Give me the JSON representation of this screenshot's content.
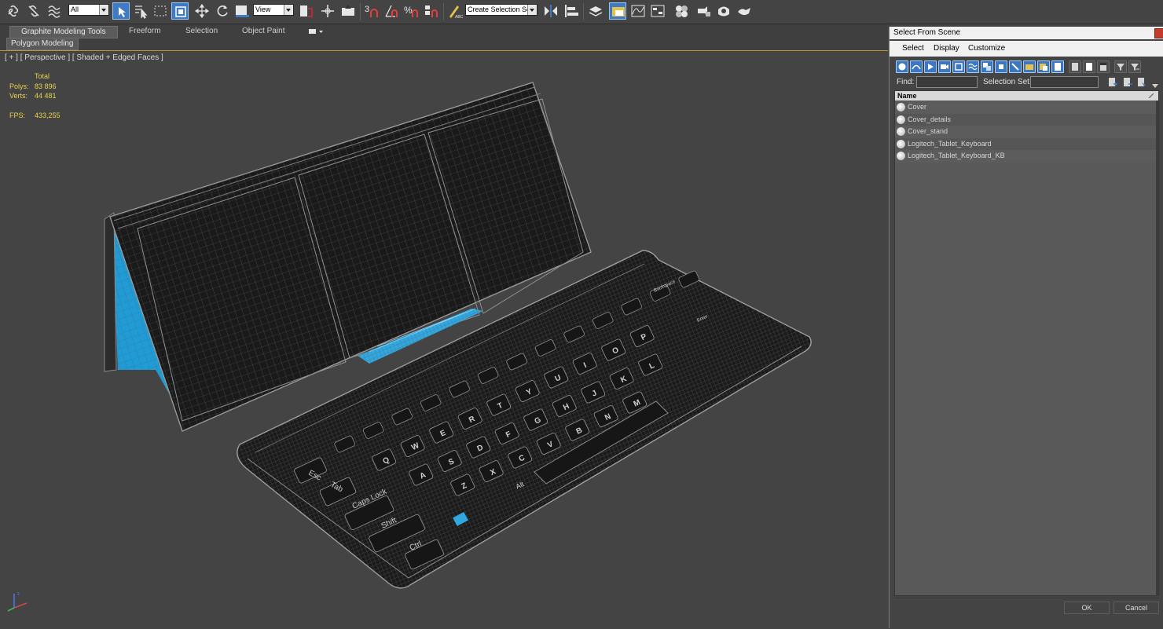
{
  "toolbar": {
    "filter_select": "All",
    "reference_select": "View",
    "selection_set_placeholder": "Create Selection Se",
    "snap_label": "3"
  },
  "ribbon": {
    "tabs": [
      {
        "label": "Graphite Modeling Tools"
      },
      {
        "label": "Freeform"
      },
      {
        "label": "Selection"
      },
      {
        "label": "Object Paint"
      }
    ],
    "panel_label": "Polygon Modeling"
  },
  "viewport": {
    "label": "[ + ] [ Perspective ] [ Shaded + Edged Faces ]",
    "stats": {
      "header": "Total",
      "polys_label": "Polys:",
      "polys_value": "83 896",
      "verts_label": "Verts:",
      "verts_value": "44 481",
      "fps_label": "FPS:",
      "fps_value": "433,255"
    },
    "keys": {
      "esc": "Esc",
      "tab": "Tab",
      "caps": "Caps Lock",
      "shift": "Shift",
      "ctrl": "Ctrl",
      "alt": "Alt",
      "q": "Q",
      "w": "W",
      "e": "E",
      "r": "R",
      "t": "T",
      "y": "Y",
      "u": "U",
      "i": "I",
      "o": "O",
      "p": "P",
      "a": "A",
      "s": "S",
      "d": "D",
      "f": "F",
      "g": "G",
      "h": "H",
      "j": "J",
      "k": "K",
      "l": "L",
      "z": "Z",
      "x": "X",
      "c": "C",
      "v": "V",
      "b": "B",
      "n": "N",
      "m": "M",
      "backspace": "Backspace",
      "enter": "Enter"
    }
  },
  "dialog": {
    "title": "Select From Scene",
    "menu": [
      {
        "label": "Select"
      },
      {
        "label": "Display"
      },
      {
        "label": "Customize"
      }
    ],
    "find_label": "Find:",
    "selection_set_label": "Selection Set:",
    "column_header": "Name",
    "items": [
      {
        "name": "Cover"
      },
      {
        "name": "Cover_details"
      },
      {
        "name": "Cover_stand"
      },
      {
        "name": "Logitech_Tablet_Keyboard"
      },
      {
        "name": "Logitech_Tablet_Keyboard_KB"
      }
    ],
    "ok_label": "OK",
    "cancel_label": "Cancel"
  },
  "colors": {
    "accent": "#3f7bc4",
    "stats_text": "#e8d44a",
    "viewport_bg": "#444444",
    "stand_blue": "#1f9bd6"
  }
}
